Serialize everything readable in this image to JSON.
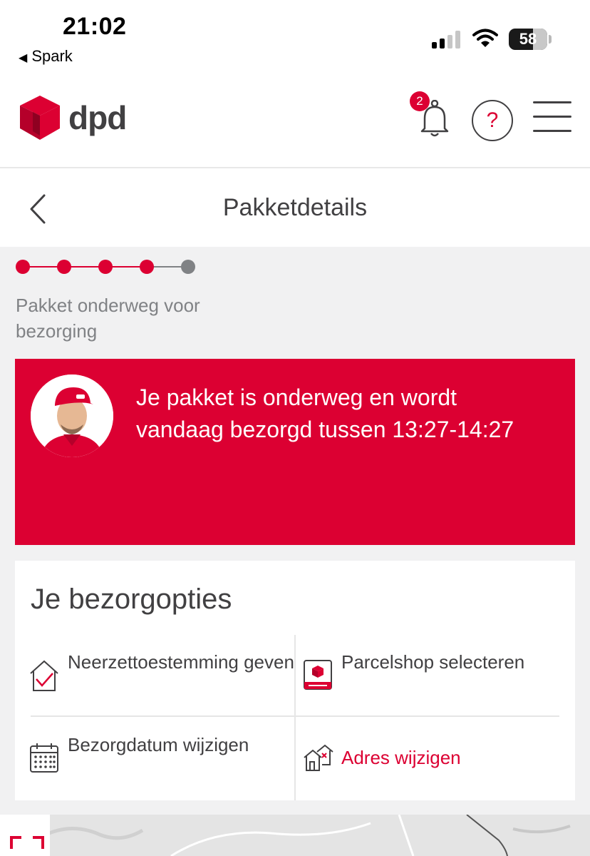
{
  "status_bar": {
    "time": "21:02",
    "back_app": "Spark",
    "battery": "58"
  },
  "header": {
    "logo_text": "dpd",
    "notification_count": "2",
    "help_symbol": "?"
  },
  "page": {
    "title": "Pakketdetails"
  },
  "tracking": {
    "steps_total": 5,
    "steps_completed": 4,
    "status_label": "Pakket onderweg voor bezorging",
    "message": "Je pakket is onderweg en wordt vandaag bezorgd tussen 13:27-14:27"
  },
  "delivery_options": {
    "title": "Je bezorgopties",
    "items": [
      {
        "label": "Neerzettoestemming geven",
        "icon": "house-check-icon"
      },
      {
        "label": "Parcelshop selecteren",
        "icon": "parcelshop-icon"
      },
      {
        "label": "Bezorgdatum wijzigen",
        "icon": "calendar-icon"
      },
      {
        "label": "Adres wijzigen",
        "icon": "change-address-icon"
      }
    ]
  },
  "colors": {
    "brand_red": "#dc0032",
    "text_dark": "#414042",
    "text_muted": "#808285",
    "step_inactive": "#808285",
    "background": "#f1f1f2"
  }
}
